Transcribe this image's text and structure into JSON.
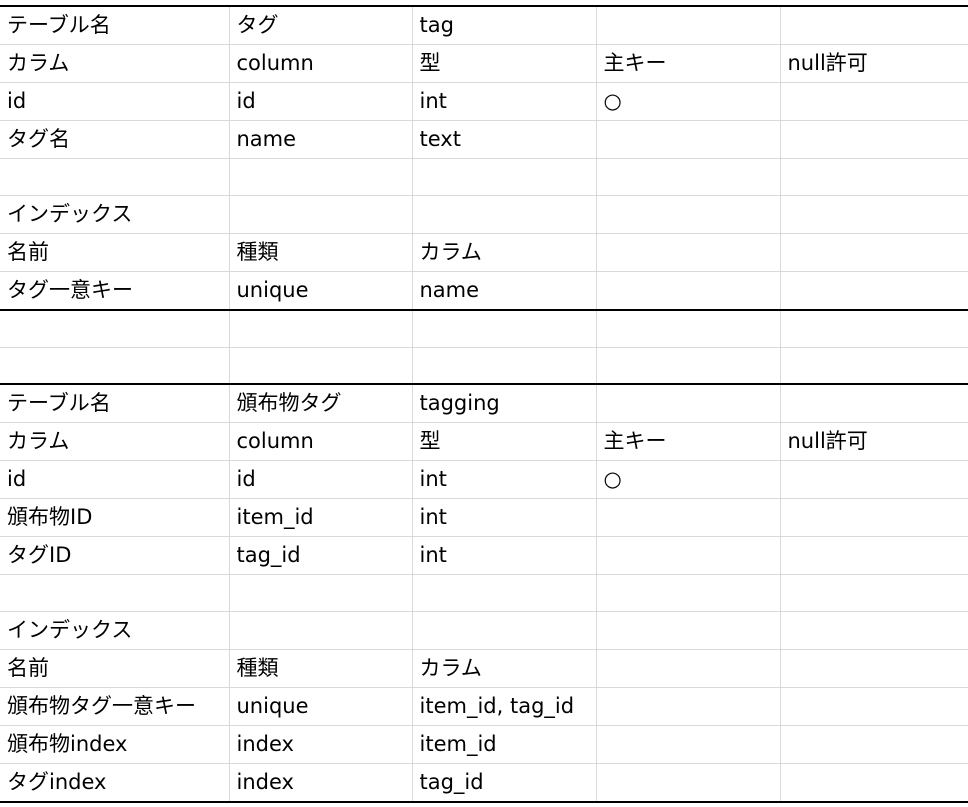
{
  "sheet": {
    "rows": [
      [
        "テーブル名",
        "タグ",
        "tag",
        "",
        ""
      ],
      [
        "カラム",
        "column",
        "型",
        "主キー",
        "null許可"
      ],
      [
        "id",
        "id",
        "int",
        "○",
        ""
      ],
      [
        "タグ名",
        "name",
        "text",
        "",
        ""
      ],
      [
        "",
        "",
        "",
        "",
        ""
      ],
      [
        "インデックス",
        "",
        "",
        "",
        ""
      ],
      [
        "名前",
        "種類",
        "カラム",
        "",
        ""
      ],
      [
        "タグ一意キー",
        "unique",
        "name",
        "",
        ""
      ],
      [
        "",
        "",
        "",
        "",
        ""
      ],
      [
        "",
        "",
        "",
        "",
        ""
      ],
      [
        "テーブル名",
        "頒布物タグ",
        "tagging",
        "",
        ""
      ],
      [
        "カラム",
        "column",
        "型",
        "主キー",
        "null許可"
      ],
      [
        "id",
        "id",
        "int",
        "○",
        ""
      ],
      [
        "頒布物ID",
        "item_id",
        "int",
        "",
        ""
      ],
      [
        "タグID",
        "tag_id",
        "int",
        "",
        ""
      ],
      [
        "",
        "",
        "",
        "",
        ""
      ],
      [
        "インデックス",
        "",
        "",
        "",
        ""
      ],
      [
        "名前",
        "種類",
        "カラム",
        "",
        ""
      ],
      [
        "頒布物タグ一意キー",
        "unique",
        "item_id, tag_id",
        "",
        ""
      ],
      [
        "頒布物index",
        "index",
        "item_id",
        "",
        ""
      ],
      [
        "タグindex",
        "index",
        "tag_id",
        "",
        ""
      ]
    ]
  }
}
